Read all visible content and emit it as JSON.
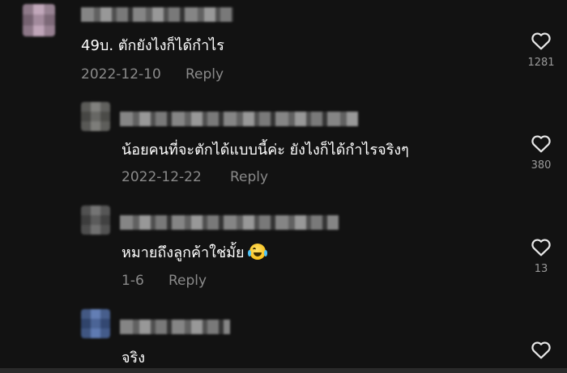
{
  "comments": [
    {
      "text": "49บ. ตักยังไงก็ได้กำไร",
      "date": "2022-12-10",
      "reply": "Reply",
      "likes": "1281"
    },
    {
      "text": "น้อยคนที่จะตักได้แบบนี้ค่ะ ยังไงก็ได้กำไรจริงๆ",
      "date": "2022-12-22",
      "reply": "Reply",
      "likes": "380"
    },
    {
      "text": "หมายถึงลูกค้าใช่มั้ย",
      "date": "1-6",
      "reply": "Reply",
      "likes": "13"
    },
    {
      "text": "จริง",
      "likes": ""
    }
  ],
  "icons": {
    "like": "heart-outline-icon",
    "emoji": "face-with-tears-of-joy-icon"
  },
  "colors": {
    "background": "#121212",
    "text": "#ffffff",
    "muted": "#8a8a8a"
  }
}
